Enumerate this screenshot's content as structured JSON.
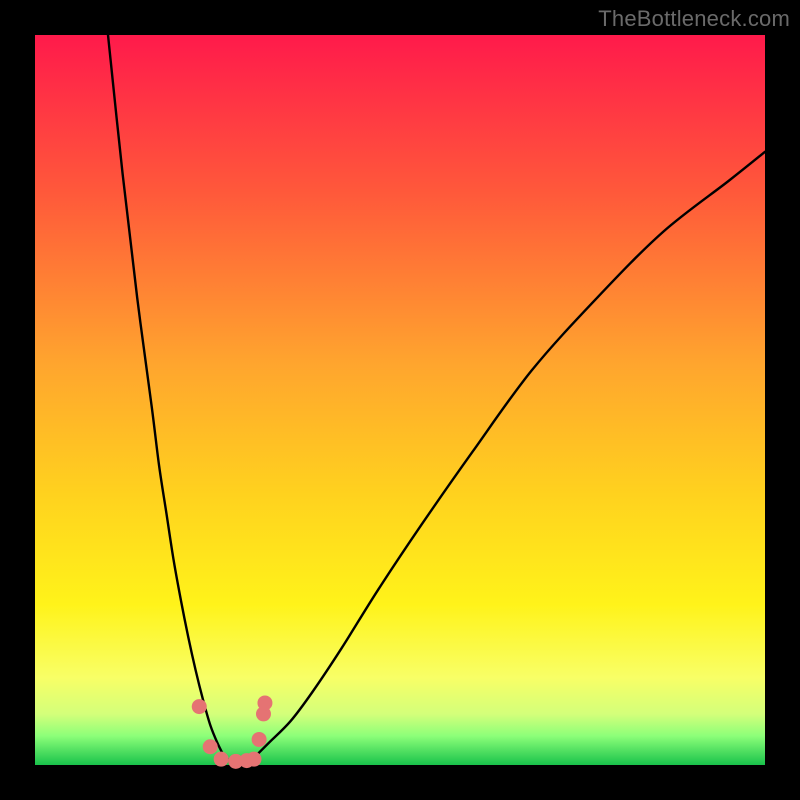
{
  "watermark": "TheBottleneck.com",
  "colors": {
    "black": "#000000",
    "curve": "#000000",
    "dot": "#e57373",
    "gradient_stops": [
      {
        "pct": 0,
        "color": "#ff1a4b"
      },
      {
        "pct": 22,
        "color": "#ff5a3a"
      },
      {
        "pct": 45,
        "color": "#ffa52e"
      },
      {
        "pct": 63,
        "color": "#ffd21e"
      },
      {
        "pct": 78,
        "color": "#fff31a"
      },
      {
        "pct": 88,
        "color": "#f8ff66"
      },
      {
        "pct": 93,
        "color": "#d4ff7a"
      },
      {
        "pct": 96,
        "color": "#8dff79"
      },
      {
        "pct": 100,
        "color": "#19c24b"
      }
    ]
  },
  "chart_data": {
    "type": "line",
    "title": "",
    "xlabel": "",
    "ylabel": "",
    "xlim": [
      0,
      100
    ],
    "ylim": [
      0,
      100
    ],
    "series": [
      {
        "name": "left-branch",
        "x": [
          10,
          12,
          14,
          16,
          17,
          18,
          19,
          20,
          21,
          22,
          23,
          24,
          25,
          26
        ],
        "y": [
          100,
          81,
          64,
          49,
          41,
          34.5,
          28,
          22.5,
          17.5,
          13,
          9,
          5.5,
          3,
          1
        ]
      },
      {
        "name": "right-branch",
        "x": [
          30,
          32,
          35,
          38,
          42,
          47,
          53,
          60,
          68,
          77,
          86,
          95,
          100
        ],
        "y": [
          1,
          3,
          6,
          10,
          16,
          24,
          33,
          43,
          54,
          64,
          73,
          80,
          84
        ]
      },
      {
        "name": "valley-floor",
        "x": [
          26,
          27,
          28,
          29,
          30
        ],
        "y": [
          1,
          0.5,
          0.4,
          0.5,
          1
        ]
      }
    ],
    "scatter": {
      "name": "dots",
      "x": [
        22.5,
        24.0,
        25.5,
        27.5,
        29.0,
        30.0,
        30.7,
        31.3,
        31.5
      ],
      "y": [
        8.0,
        2.5,
        0.8,
        0.5,
        0.6,
        0.8,
        3.5,
        7.0,
        8.5
      ]
    }
  }
}
